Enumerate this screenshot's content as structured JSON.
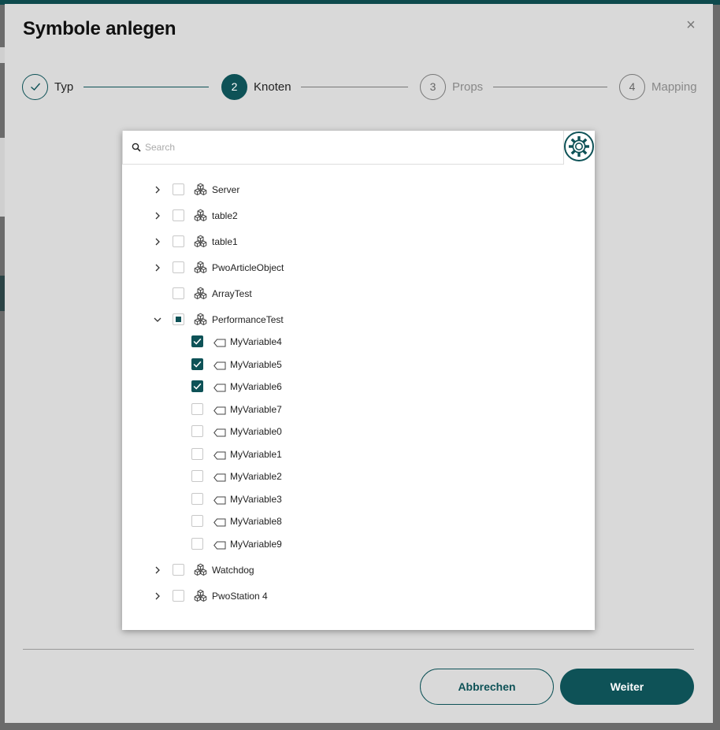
{
  "dialog": {
    "title": "Symbole anlegen",
    "close_glyph": "×"
  },
  "stepper": {
    "steps": [
      {
        "number": "✓",
        "label": "Typ",
        "state": "done"
      },
      {
        "number": "2",
        "label": "Knoten",
        "state": "active"
      },
      {
        "number": "3",
        "label": "Props",
        "state": "pending"
      },
      {
        "number": "4",
        "label": "Mapping",
        "state": "pending"
      }
    ]
  },
  "search": {
    "placeholder": "Search",
    "value": ""
  },
  "tree": {
    "nodes": [
      {
        "label": "Server",
        "expandable": true,
        "expanded": false,
        "checked": "none"
      },
      {
        "label": "table2",
        "expandable": true,
        "expanded": false,
        "checked": "none"
      },
      {
        "label": "table1",
        "expandable": true,
        "expanded": false,
        "checked": "none"
      },
      {
        "label": "PwoArticleObject",
        "expandable": true,
        "expanded": false,
        "checked": "none"
      },
      {
        "label": "ArrayTest",
        "expandable": false,
        "expanded": false,
        "checked": "none"
      },
      {
        "label": "PerformanceTest",
        "expandable": true,
        "expanded": true,
        "checked": "partial",
        "children": [
          {
            "label": "MyVariable4",
            "checked": true
          },
          {
            "label": "MyVariable5",
            "checked": true
          },
          {
            "label": "MyVariable6",
            "checked": true
          },
          {
            "label": "MyVariable7",
            "checked": false
          },
          {
            "label": "MyVariable0",
            "checked": false
          },
          {
            "label": "MyVariable1",
            "checked": false
          },
          {
            "label": "MyVariable2",
            "checked": false
          },
          {
            "label": "MyVariable3",
            "checked": false
          },
          {
            "label": "MyVariable8",
            "checked": false
          },
          {
            "label": "MyVariable9",
            "checked": false
          }
        ]
      },
      {
        "label": "Watchdog",
        "expandable": true,
        "expanded": false,
        "checked": "none"
      },
      {
        "label": "PwoStation 4",
        "expandable": true,
        "expanded": false,
        "checked": "none"
      }
    ]
  },
  "footer": {
    "cancel_label": "Abbrechen",
    "next_label": "Weiter"
  },
  "colors": {
    "accent": "#0e5257",
    "dialog_bg": "#d9d9d9",
    "overlay_bg": "#6b6b6b"
  }
}
